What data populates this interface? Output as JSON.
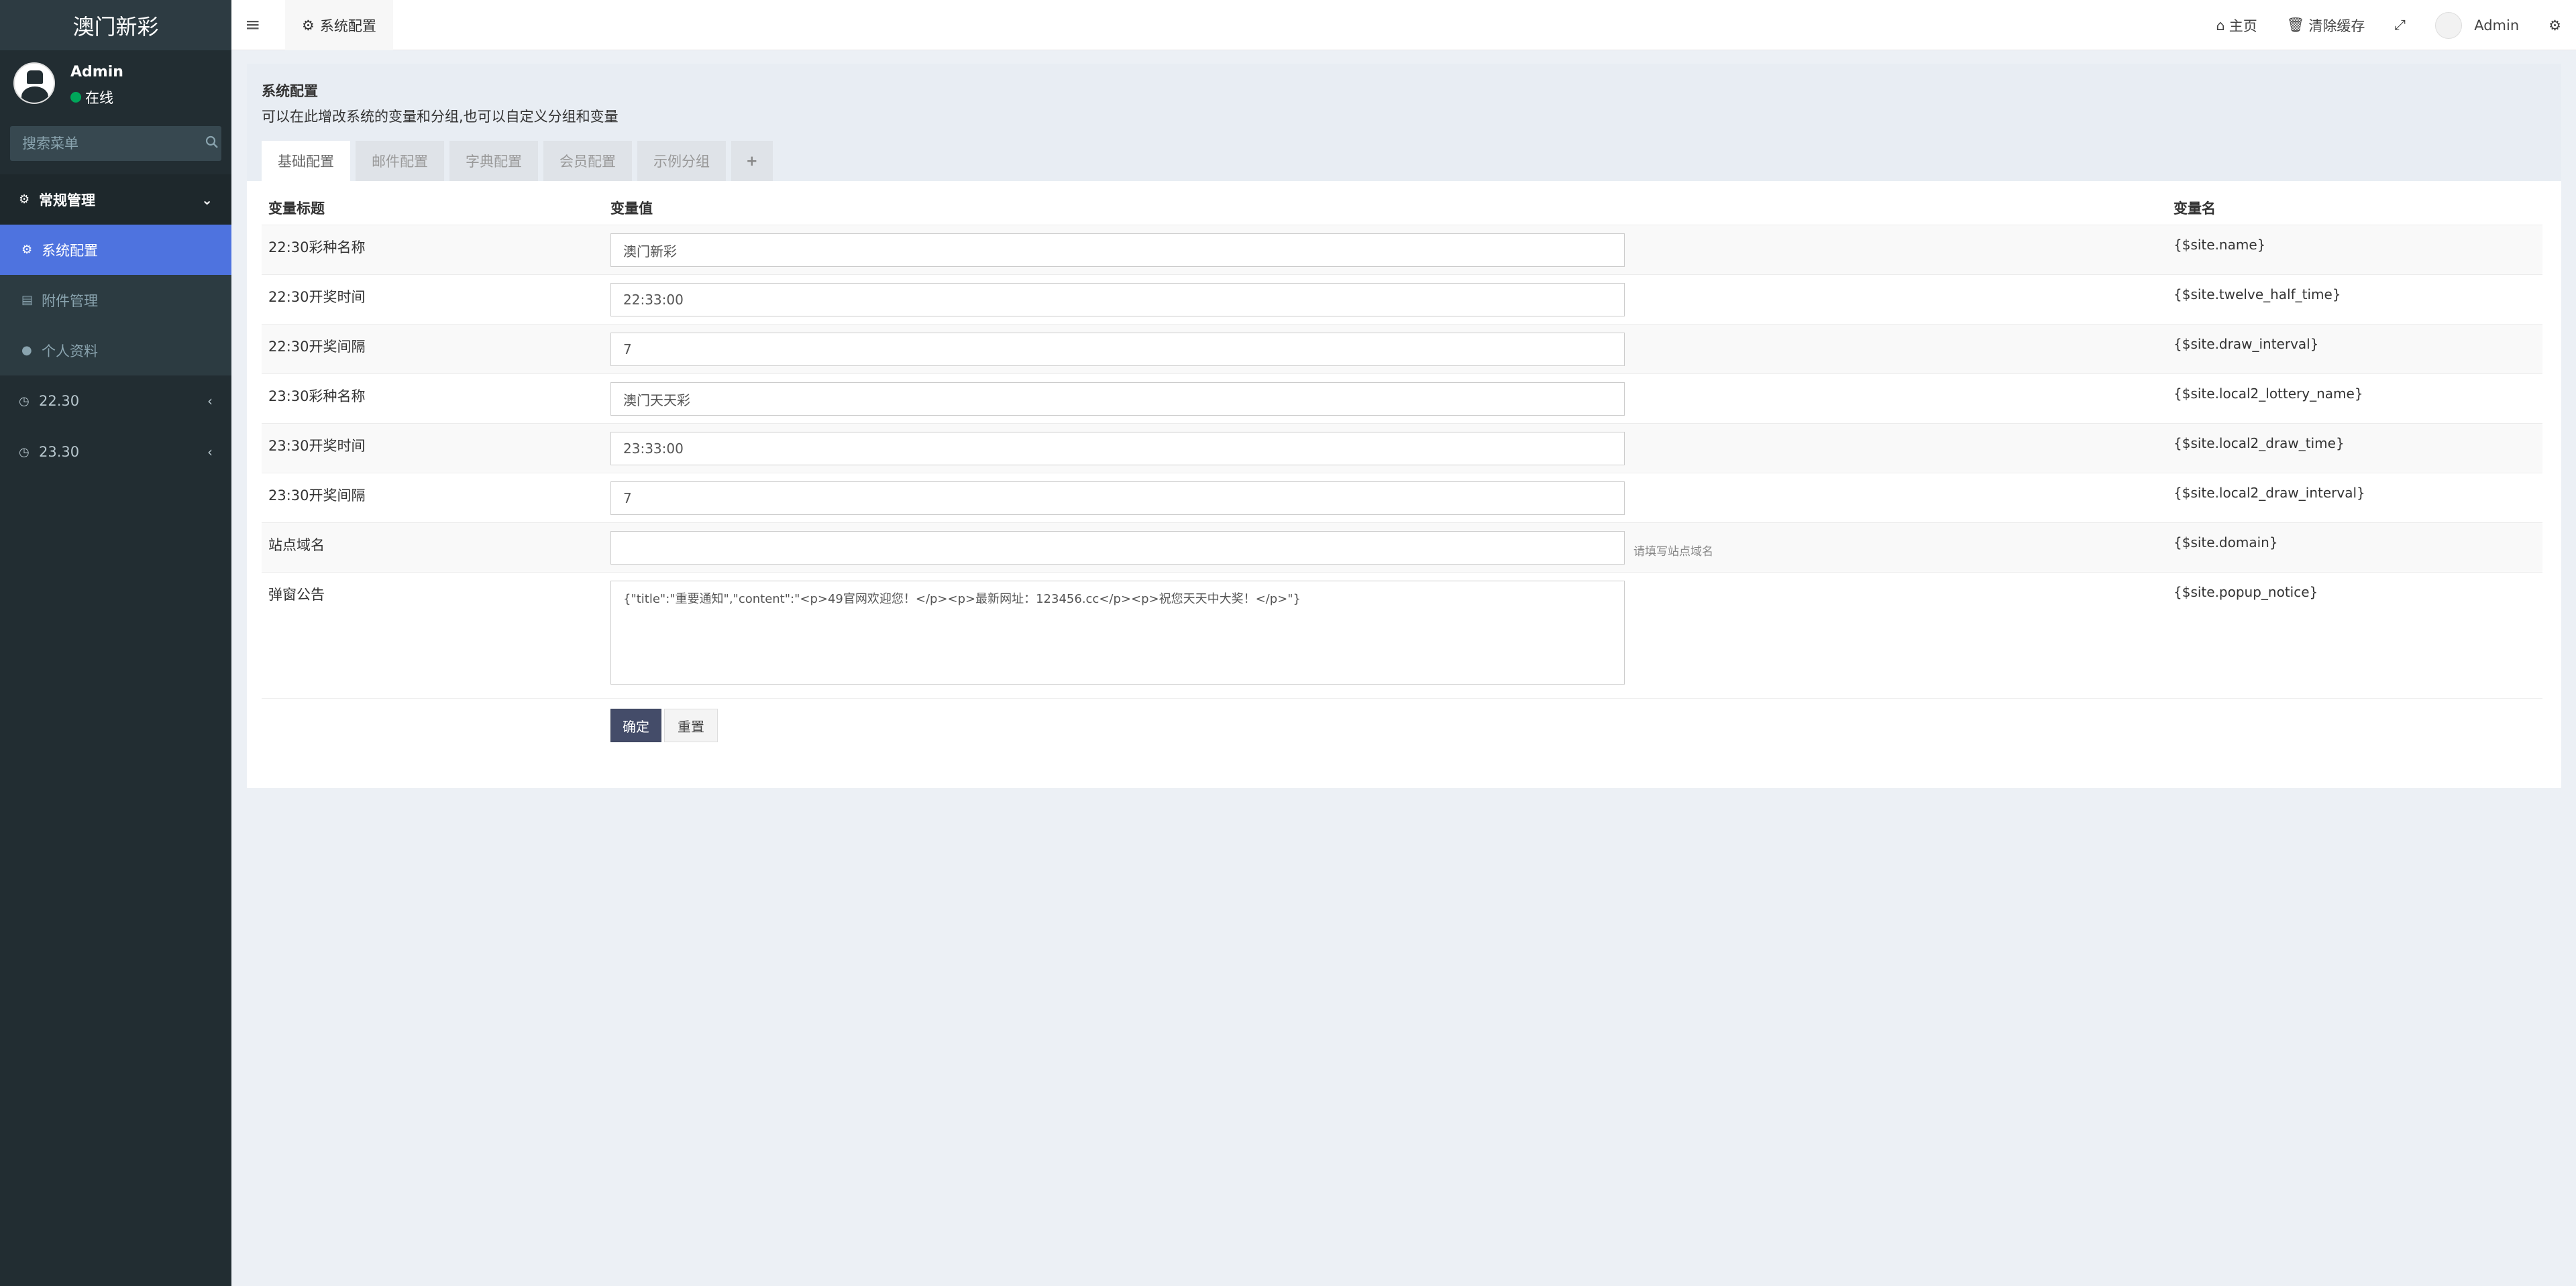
{
  "app": {
    "logo": "澳门新彩"
  },
  "user": {
    "name": "Admin",
    "status": "在线"
  },
  "sidebar": {
    "search_placeholder": "搜索菜单",
    "header": "常规管理",
    "items": [
      {
        "label": "系统配置",
        "icon": "gear-icon"
      },
      {
        "label": "附件管理",
        "icon": "file-image-icon"
      },
      {
        "label": "个人资料",
        "icon": "user-icon"
      }
    ],
    "groups": [
      {
        "label": "22.30",
        "icon": "clock-icon"
      },
      {
        "label": "23.30",
        "icon": "clock-icon"
      }
    ]
  },
  "topbar": {
    "tab_label": "系统配置",
    "home": "主页",
    "clear_cache": "清除缓存",
    "user": "Admin"
  },
  "panel": {
    "title": "系统配置",
    "description": "可以在此增改系统的变量和分组,也可以自定义分组和变量",
    "tabs": [
      "基础配置",
      "邮件配置",
      "字典配置",
      "会员配置",
      "示例分组"
    ],
    "add_tab": "+"
  },
  "table": {
    "headers": {
      "title": "变量标题",
      "value": "变量值",
      "name": "变量名"
    },
    "rows": [
      {
        "title": "22:30彩种名称",
        "value": "澳门新彩",
        "name": "{$site.name}"
      },
      {
        "title": "22:30开奖时间",
        "value": "22:33:00",
        "name": "{$site.twelve_half_time}"
      },
      {
        "title": "22:30开奖间隔",
        "value": "7",
        "name": "{$site.draw_interval}"
      },
      {
        "title": "23:30彩种名称",
        "value": "澳门天天彩",
        "name": "{$site.local2_lottery_name}"
      },
      {
        "title": "23:30开奖时间",
        "value": "23:33:00",
        "name": "{$site.local2_draw_time}"
      },
      {
        "title": "23:30开奖间隔",
        "value": "7",
        "name": "{$site.local2_draw_interval}"
      },
      {
        "title": "站点域名",
        "value": "",
        "name": "{$site.domain}",
        "help": "请填写站点域名"
      }
    ],
    "notice": {
      "title": "弹窗公告",
      "value": "{\"title\":\"重要通知\",\"content\":\"<p>49官网欢迎您！</p><p>最新网址：123456.cc</p><p>祝您天天中大奖！</p>\"}",
      "name": "{$site.popup_notice}"
    }
  },
  "buttons": {
    "submit": "确定",
    "reset": "重置"
  }
}
